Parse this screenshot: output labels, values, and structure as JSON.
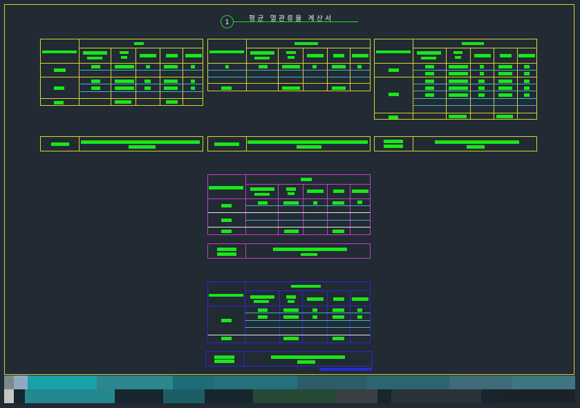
{
  "drawing": {
    "title": "평균 열관류율 계산서",
    "detail_number": "1"
  },
  "colors": {
    "background": "#222a34",
    "frame": "#d6d62c",
    "text_bar": "#19e619",
    "tables_top": "#d6d62c",
    "table_magenta": "#c83ec8",
    "table_blue": "#2a2ad6",
    "row_divider": "#3fb6c8",
    "white_line": "#e8e8e8",
    "title_underline": "#2bd62b"
  },
  "statusbar": {
    "state": "blurred"
  }
}
